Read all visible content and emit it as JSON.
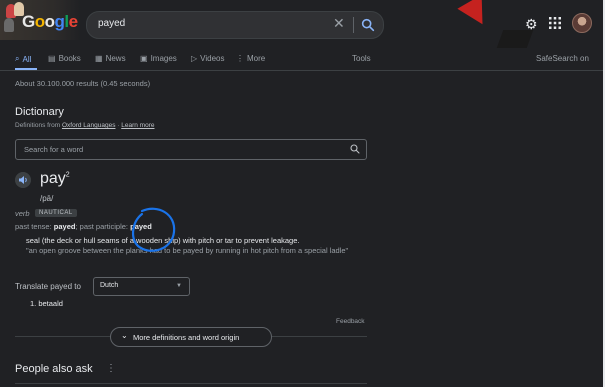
{
  "header": {
    "logo_letters": [
      "G",
      "o",
      "o",
      "g",
      "l",
      "e"
    ],
    "search_query": "payed",
    "clear_icon": "close-icon",
    "search_icon": "search-icon",
    "settings_icon": "gear-icon",
    "apps_icon": "apps-grid-icon"
  },
  "tabs": [
    {
      "label": "All",
      "icon": "search-icon",
      "active": true
    },
    {
      "label": "Books",
      "icon": "book-icon"
    },
    {
      "label": "News",
      "icon": "news-icon"
    },
    {
      "label": "Images",
      "icon": "image-icon"
    },
    {
      "label": "Videos",
      "icon": "video-icon"
    },
    {
      "label": "More",
      "icon": "dots-icon"
    }
  ],
  "tools_label": "Tools",
  "safesearch_label": "SafeSearch on",
  "results_count": "About 30.100.000 results (0.45 seconds)",
  "dictionary": {
    "title": "Dictionary",
    "defs_prefix": "Definitions from",
    "source_link": "Oxford Languages",
    "learn_more": "Learn more",
    "search_placeholder": "Search for a word",
    "word": "pay",
    "superscript": "2",
    "pronunciation": "/pā/",
    "part_of_speech": "verb",
    "badge": "NAUTICAL",
    "forms_prefix": "past tense:",
    "past_tense": "payed",
    "participle_prefix": "; past participle:",
    "past_participle": "payed",
    "definition": "seal (the deck or hull seams of a wooden ship) with pitch or tar to prevent leakage.",
    "example": "\"an open groove between the planks had to be payed by running in hot pitch from a special ladle\"",
    "translate_label": "Translate payed to",
    "translate_lang": "Dutch",
    "translation": "1. betaald",
    "feedback": "Feedback",
    "more_defs": "More definitions and word origin"
  },
  "people_also_ask": "People also ask",
  "colors": {
    "background": "#202124",
    "accent": "#8ab4f8",
    "annotation": "#1a73e8"
  }
}
